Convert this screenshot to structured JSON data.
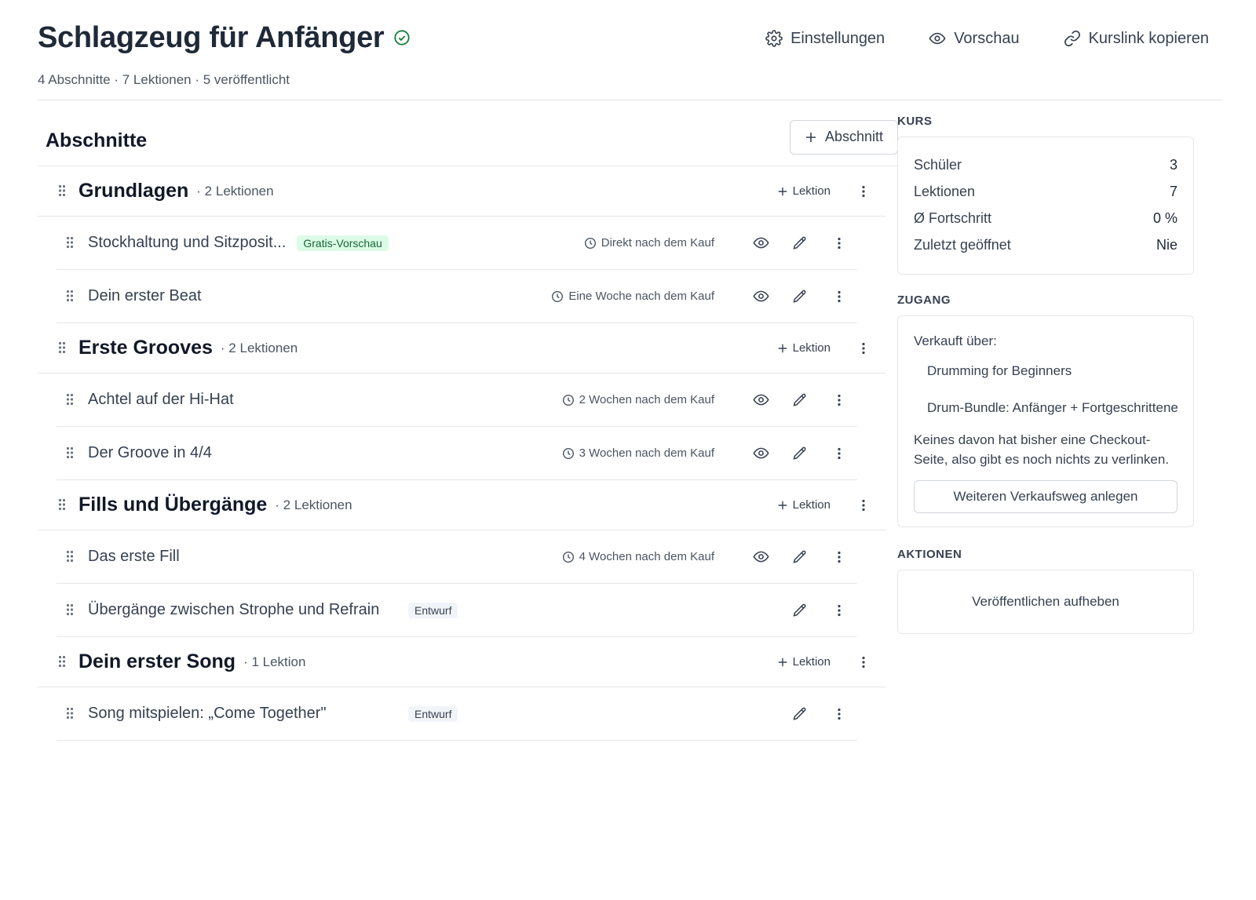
{
  "header": {
    "title": "Schlagzeug für Anfänger",
    "subtitle": "4 Abschnitte · 7 Lektionen · 5 veröffentlicht",
    "actions": [
      {
        "label": "Einstellungen",
        "icon": "gear-icon"
      },
      {
        "label": "Vorschau",
        "icon": "eye-icon"
      },
      {
        "label": "Kurslink kopieren",
        "icon": "link-icon"
      }
    ]
  },
  "sections_panel": {
    "title": "Abschnitte",
    "add_section_label": "Abschnitt",
    "add_lesson_label": "Lektion",
    "sections": [
      {
        "name": "Grundlagen",
        "count": "· 2 Lektionen",
        "lessons": [
          {
            "title": "Stockhaltung und Sitzposit...",
            "badge": "Gratis-Vorschau",
            "release": "Direkt nach dem Kauf"
          },
          {
            "title": "Dein erster Beat",
            "release": "Eine Woche nach dem Kauf"
          }
        ]
      },
      {
        "name": "Erste Grooves",
        "count": "· 2 Lektionen",
        "lessons": [
          {
            "title": "Achtel auf der Hi-Hat",
            "release": "2 Wochen nach dem Kauf"
          },
          {
            "title": "Der Groove in 4/4",
            "release": "3 Wochen nach dem Kauf"
          }
        ]
      },
      {
        "name": "Fills und Übergänge",
        "count": "· 2 Lektionen",
        "lessons": [
          {
            "title": "Das erste Fill",
            "release": "4 Wochen nach dem Kauf"
          },
          {
            "title": "Übergänge zwischen Strophe und Refrain",
            "draft": "Entwurf"
          }
        ]
      },
      {
        "name": "Dein erster Song",
        "count": "· 1 Lektion",
        "lessons": [
          {
            "title": "Song mitspielen: „Come Together\"",
            "draft": "Entwurf"
          }
        ]
      }
    ]
  },
  "sidebar": {
    "course": {
      "label": "KURS",
      "stats": [
        {
          "label": "Schüler",
          "value": "3"
        },
        {
          "label": "Lektionen",
          "value": "7"
        },
        {
          "label": "Ø Fortschritt",
          "value": "0 %"
        },
        {
          "label": "Zuletzt geöffnet",
          "value": "Nie"
        }
      ]
    },
    "access": {
      "label": "ZUGANG",
      "sold_via": "Verkauft über:",
      "products": [
        "Drumming for Beginners",
        "Drum-Bundle: Anfänger + Fortgeschrittene"
      ],
      "note": "Keines davon hat bisher eine Checkout-Seite, also gibt es noch nichts zu verlinken.",
      "button": "Weiteren Verkaufsweg anlegen"
    },
    "actions": {
      "label": "AKTIONEN",
      "unpublish": "Veröffentlichen aufheben"
    }
  },
  "colors": {
    "verified": "#15803d",
    "free_badge_bg": "#dcfce7",
    "free_badge_text": "#166534",
    "draft_badge_bg": "#f1f5f9",
    "divider": "#e5e7eb"
  }
}
